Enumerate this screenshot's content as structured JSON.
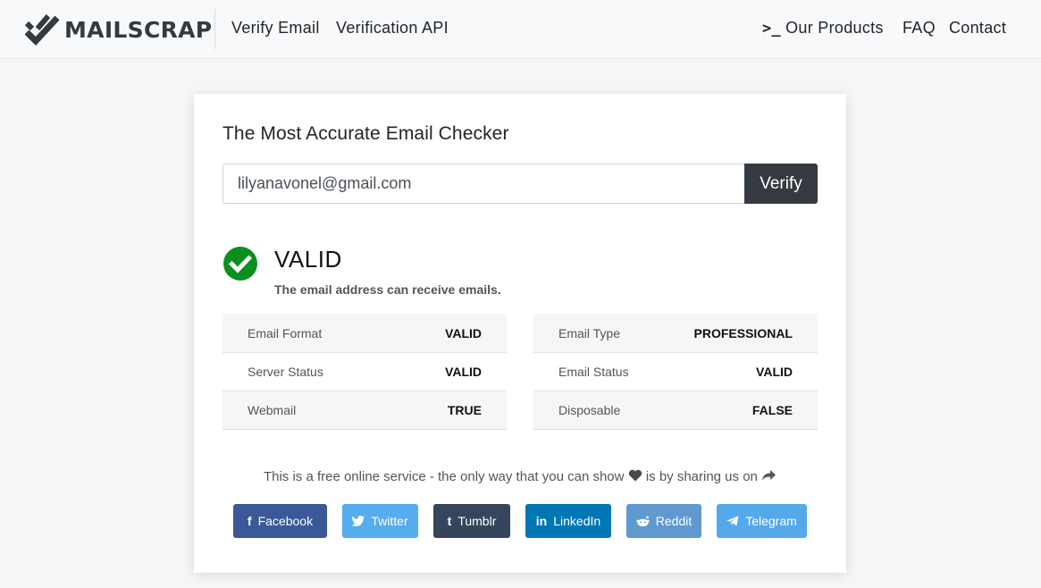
{
  "header": {
    "brand": "MAILSCRAP",
    "nav_left": [
      "Verify Email",
      "Verification API"
    ],
    "nav_right": {
      "products": "Our Products",
      "faq": "FAQ",
      "contact": "Contact"
    }
  },
  "card": {
    "title": "The Most Accurate Email Checker",
    "email_value": "lilyanavonel@gmail.com",
    "verify_label": "Verify",
    "status": "VALID",
    "status_desc": "The email address can receive emails.",
    "status_color": "#0a8f1e",
    "left_table": [
      {
        "label": "Email Format",
        "value": "VALID"
      },
      {
        "label": "Server Status",
        "value": "VALID"
      },
      {
        "label": "Webmail",
        "value": "TRUE"
      }
    ],
    "right_table": [
      {
        "label": "Email Type",
        "value": "PROFESSIONAL"
      },
      {
        "label": "Email Status",
        "value": "VALID"
      },
      {
        "label": "Disposable",
        "value": "FALSE"
      }
    ],
    "share_text_before": "This is a free online service - the only way that you can show",
    "share_text_after": "is by sharing us on",
    "share_buttons": [
      {
        "label": "Facebook",
        "icon": "facebook-icon",
        "color": "#3b5998"
      },
      {
        "label": "Twitter",
        "icon": "twitter-icon",
        "color": "#55acee"
      },
      {
        "label": "Tumblr",
        "icon": "tumblr-icon",
        "color": "#35465c"
      },
      {
        "label": "LinkedIn",
        "icon": "linkedin-icon",
        "color": "#0077b5"
      },
      {
        "label": "Reddit",
        "icon": "reddit-icon",
        "color": "#5f99cf"
      },
      {
        "label": "Telegram",
        "icon": "telegram-icon",
        "color": "#54a9eb"
      }
    ]
  }
}
